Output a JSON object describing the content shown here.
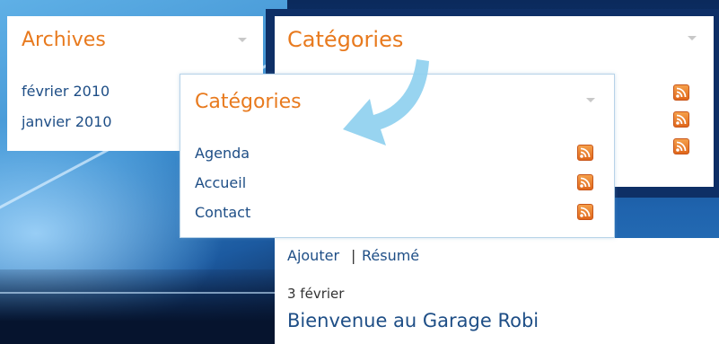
{
  "colors": {
    "title_orange": "#e87a1e",
    "link_blue": "#1e4e86",
    "rss_orange": "#e8781f",
    "arrow_blue": "#8fd0ef"
  },
  "archives": {
    "title": "Archives",
    "items": [
      "février 2010",
      "janvier 2010"
    ]
  },
  "categories_back": {
    "title": "Catégories"
  },
  "categories_front": {
    "title": "Catégories",
    "items": [
      "Agenda",
      "Accueil",
      "Contact"
    ]
  },
  "content": {
    "links": {
      "add": "Ajouter",
      "separator": "|",
      "summary": "Résumé"
    },
    "post_date": "3 février",
    "post_title": "Bienvenue au Garage Robi"
  },
  "icons": {
    "feed": "rss-feed-icon",
    "collapse": "chevron-down-icon",
    "pointer": "curved-arrow-icon"
  }
}
